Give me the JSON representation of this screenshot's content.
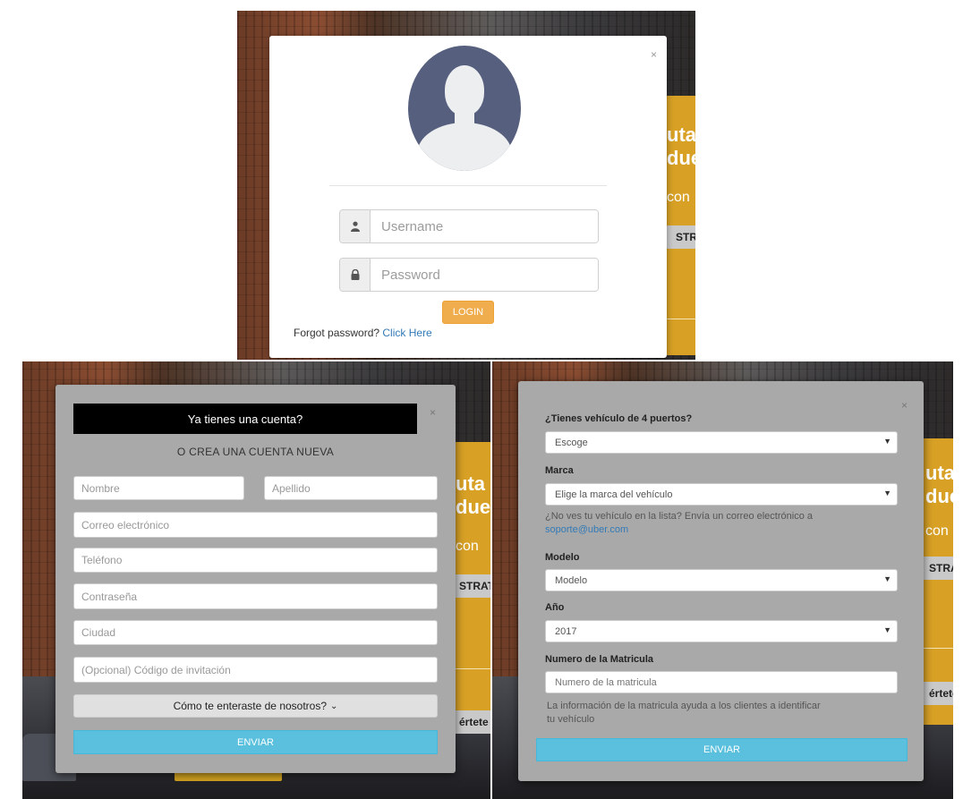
{
  "login": {
    "close": "×",
    "username_placeholder": "Username",
    "password_placeholder": "Password",
    "login_button": "LOGIN",
    "forgot_text": "Forgot password?",
    "forgot_link": "Click Here"
  },
  "register": {
    "header": "Ya tienes una cuenta?",
    "subtitle": "O CREA UNA CUENTA NUEVA",
    "close": "×",
    "fields": {
      "nombre": "Nombre",
      "apellido": "Apellido",
      "correo": "Correo electrónico",
      "telefono": "Teléfono",
      "contrasena": "Contraseña",
      "ciudad": "Ciudad",
      "invitacion": "(Opcional) Código de invitación"
    },
    "how_found": "Cómo te enteraste de nosotros?",
    "send_button": "ENVIAR"
  },
  "vehicle": {
    "close": "×",
    "q_doors_label": "¿Tienes vehículo de 4 puertos?",
    "q_doors_value": "Escoge",
    "marca_label": "Marca",
    "marca_value": "Elige la marca del vehículo",
    "marca_help": "¿No ves tu vehículo en la lista? Envía un correo electrónico a",
    "marca_help_link": "soporte@uber.com",
    "modelo_label": "Modelo",
    "modelo_value": "Modelo",
    "ano_label": "Año",
    "ano_value": "2017",
    "matricula_label": "Numero de la Matricula",
    "matricula_placeholder": "Numero de la matricula",
    "matricula_help": "La información de la matricula ayuda a los clientes a identificar tu vehículo",
    "send_button": "ENVIAR"
  },
  "background": {
    "hero_line1": "uta",
    "hero_line2": "due",
    "hero_sub": "con",
    "strip_btn": "STRATE",
    "strip_btn2": "értete"
  }
}
